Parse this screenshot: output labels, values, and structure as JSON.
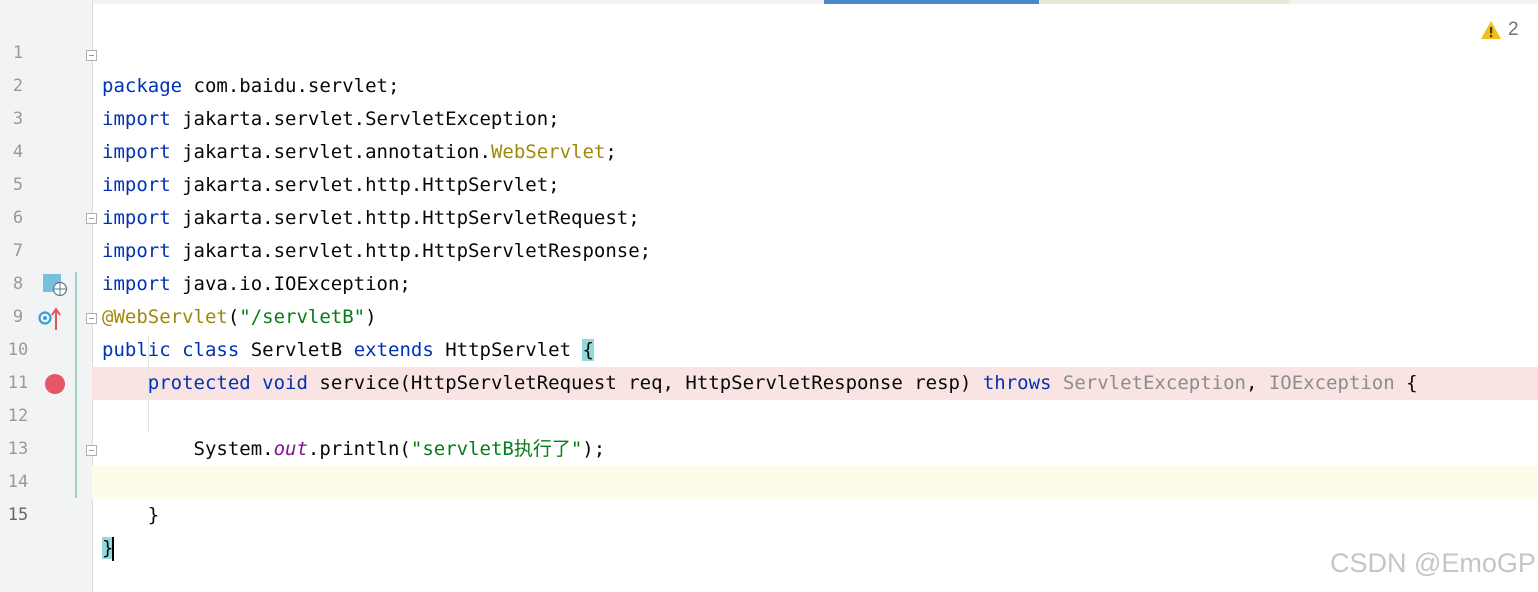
{
  "editor": {
    "line_numbers": [
      "1",
      "2",
      "3",
      "4",
      "5",
      "6",
      "7",
      "8",
      "9",
      "10",
      "11",
      "12",
      "13",
      "14",
      "15"
    ],
    "lines": {
      "l1_kw": "package",
      "l1_rest": " com.baidu.servlet;",
      "l2_kw": "import",
      "l2_rest": " jakarta.servlet.ServletException;",
      "l3_kw": "import",
      "l3_rest": " jakarta.servlet.annotation.",
      "l3_ann": "WebServlet",
      "l3_end": ";",
      "l4_kw": "import",
      "l4_rest": " jakarta.servlet.http.HttpServlet;",
      "l5_kw": "import",
      "l5_rest": " jakarta.servlet.http.HttpServletRequest;",
      "l6_kw": "import",
      "l6_rest": " jakarta.servlet.http.HttpServletResponse;",
      "l7_kw": "import",
      "l7_rest": " java.io.IOException;",
      "l8_ann": "@WebServlet",
      "l8_open": "(",
      "l8_str": "\"/servletB\"",
      "l8_close": ")",
      "l9_kw1": "public",
      "l9_kw2": "class",
      "l9_name": " ServletB ",
      "l9_kw3": "extends",
      "l9_rest": " HttpServlet ",
      "l9_brace": "{",
      "l10_kw1": "protected",
      "l10_kw2": "void",
      "l10_method": " service(HttpServletRequest req, HttpServletResponse resp) ",
      "l10_kw3": "throws",
      "l10_ex1": " ServletException",
      "l10_comma": ", ",
      "l10_ex2": "IOException",
      "l10_brace": " {",
      "l12_a": "System.",
      "l12_field": "out",
      "l12_b": ".println(",
      "l12_str": "\"servletB执行了\"",
      "l12_c": ");",
      "l14": "}",
      "l15": "}"
    }
  },
  "inspections": {
    "warning_count": "2"
  },
  "watermark": "CSDN @EmoGP",
  "colors": {
    "keyword": "#0033b3",
    "annotation": "#9e880d",
    "string": "#067d17",
    "breakpoint": "#e55765",
    "breakpoint_line": "#fae3e3",
    "current_line": "#fdfbe9",
    "tab_active": "#4a88c7"
  },
  "icons": {
    "line9": "servlet-web-icon",
    "line10": "overrides-method-icon",
    "line12": "breakpoint-icon",
    "status": "warning-icon"
  }
}
